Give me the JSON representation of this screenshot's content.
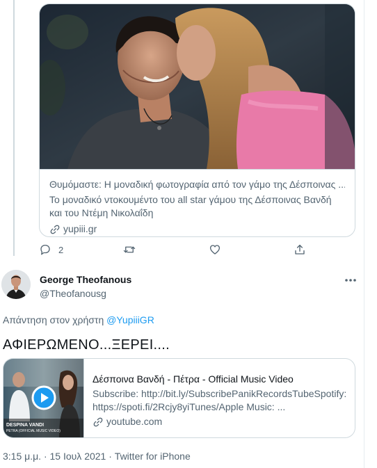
{
  "link_card": {
    "title": "Θυμόμαστε: Η μοναδική φωτογραφία από τον γάμο της Δέσποινας ...",
    "description": "Το μοναδικό ντοκουμέντο του all star γάμου της Δέσποινας Βανδή και του Ντέμη Νικολαΐδη",
    "domain": "yupiii.gr"
  },
  "actions": {
    "reply_count": "2",
    "icons": [
      "reply-icon",
      "retweet-icon",
      "like-icon",
      "share-icon"
    ]
  },
  "tweet": {
    "display_name": "George Theofanous",
    "handle": "@Theofanousg",
    "reply_prefix": "Απάντηση στον χρήστη",
    "reply_mention": "@YupiiiGR",
    "text": "ΑΦΙΕΡΩΜΕΝΟ...ΞΕΡΕΙ....",
    "video_card": {
      "title": "Δέσποινα Βανδή - Πέτρα - Official Music Video",
      "description": "Subscribe: http://bit.ly/SubscribePanikRecordsTubeSpotify: https://spoti.fi/2Rcjy8yiTunes/Apple Music: ...",
      "domain": "youtube.com",
      "thumb_caption_1": "DESPINA VANDI",
      "thumb_caption_2": "PETRA (OFFICIAL MUSIC VIDEO)"
    },
    "time": "3:15 μ.μ.",
    "date": "15 Ιουλ 2021",
    "source": "Twitter for iPhone",
    "separator": "·"
  },
  "colors": {
    "accent": "#1d9bf0",
    "secondary_text": "#536471",
    "border": "#cfd9de"
  }
}
